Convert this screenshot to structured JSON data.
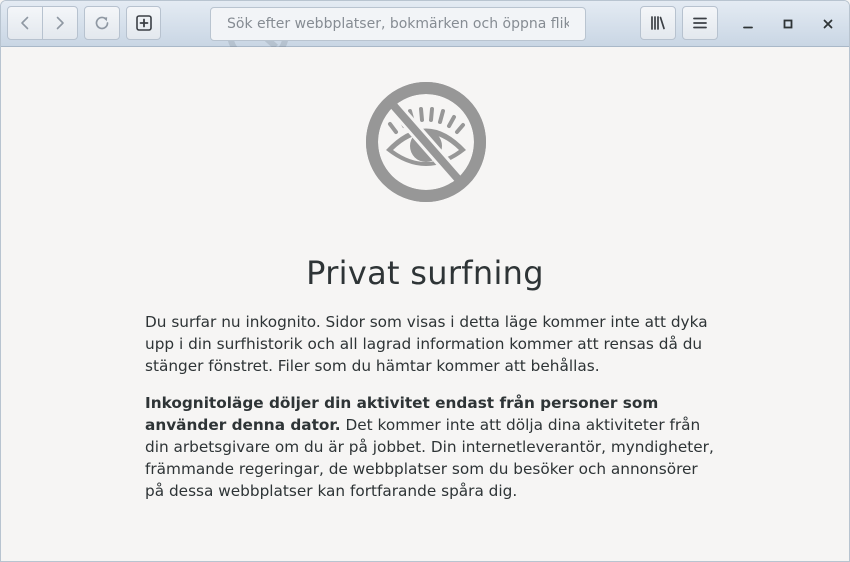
{
  "window": {
    "title": "Privat surfning"
  },
  "header": {
    "search_placeholder": "Sök efter webbplatser, bokmärken och öppna flikar",
    "buttons": {
      "back": "back-icon",
      "forward": "forward-icon",
      "reload": "reload-icon",
      "new_tab": "new-tab-icon",
      "library": "library-icon",
      "menu": "hamburger-menu-icon",
      "minimize": "minimize-icon",
      "maximize": "maximize-icon",
      "close": "close-icon"
    }
  },
  "content": {
    "icon": "incognito-eye-slash-icon",
    "title": "Privat surfning",
    "paragraph1": "Du surfar nu inkognito. Sidor som visas i detta läge kommer inte att dyka upp i din surfhistorik och all lagrad information kommer att rensas då du stänger fönstret. Filer som du hämtar kommer att behållas.",
    "paragraph2_bold": "Inkognitoläge döljer din aktivitet endast från personer som använder denna dator.",
    "paragraph2_rest": " Det kommer inte att dölja dina aktiviteter från din arbetsgivare om du är på jobbet. Din internetleverantör, myndigheter, främmande regeringar, de webbplatser som du besöker och annonsörer på dessa webbplatser kan fortfarande spåra dig."
  },
  "colors": {
    "header_top": "#e4ebf3",
    "header_bottom": "#c9d6e4",
    "background": "#f6f5f4",
    "icon_gray": "#979797",
    "text": "#2e3436"
  }
}
